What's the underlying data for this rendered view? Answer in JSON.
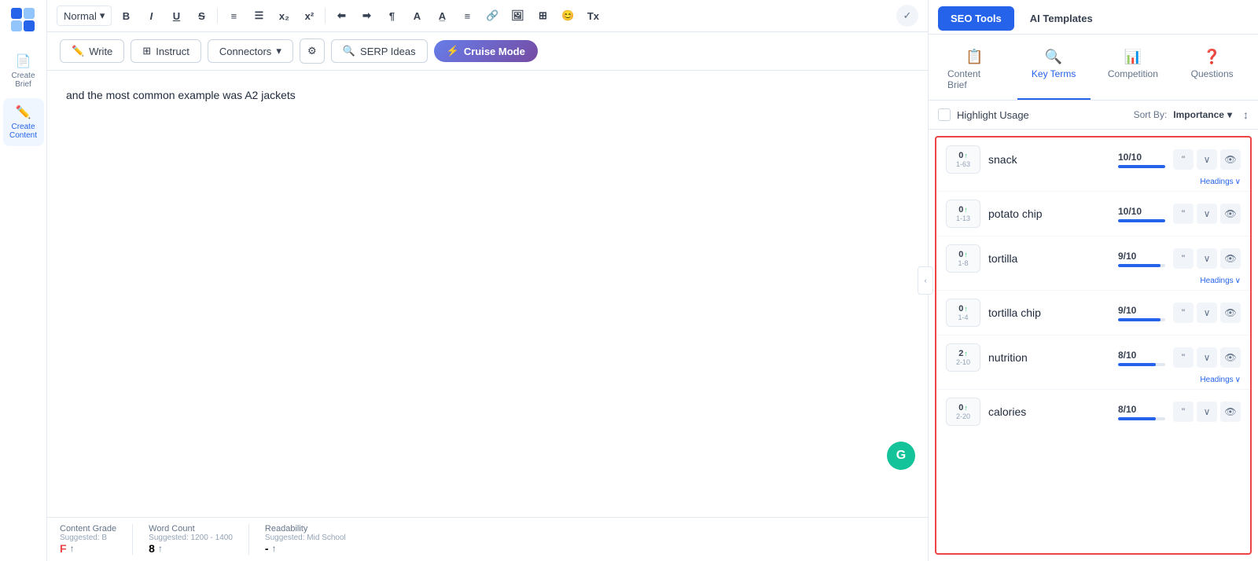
{
  "sidebar": {
    "items": [
      {
        "id": "create-brief",
        "label": "Create Brief",
        "icon": "📄",
        "active": false
      },
      {
        "id": "create-content",
        "label": "Create Content",
        "icon": "✏️",
        "active": true
      }
    ]
  },
  "toolbar": {
    "format_select": "Normal",
    "check_icon": "✓"
  },
  "action_bar": {
    "write_label": "Write",
    "instruct_label": "Instruct",
    "connectors_label": "Connectors",
    "settings_icon": "⚙",
    "serp_label": "SERP Ideas",
    "cruise_label": "Cruise Mode"
  },
  "editor": {
    "content": "and the most common example was A2 jackets"
  },
  "bottom_bar": {
    "content_grade_label": "Content Grade",
    "content_grade_suggested": "Suggested: B",
    "content_grade_value": "F",
    "word_count_label": "Word Count",
    "word_count_suggested": "Suggested: 1200 - 1400",
    "word_count_value": "8",
    "readability_label": "Readability",
    "readability_suggested": "Suggested: Mid School",
    "readability_value": "-"
  },
  "right_panel": {
    "top_tabs": [
      {
        "id": "seo-tools",
        "label": "SEO Tools",
        "active": true
      },
      {
        "id": "ai-templates",
        "label": "AI Templates",
        "active": false
      }
    ],
    "nav_tabs": [
      {
        "id": "content-brief",
        "label": "Content Brief",
        "icon": "📋",
        "active": false
      },
      {
        "id": "key-terms",
        "label": "Key Terms",
        "icon": "🔍",
        "active": true
      },
      {
        "id": "competition",
        "label": "Competition",
        "icon": "📊",
        "active": false
      },
      {
        "id": "questions",
        "label": "Questions",
        "icon": "❓",
        "active": false
      }
    ],
    "highlight_bar": {
      "checkbox_label": "Highlight Usage",
      "sort_by_label": "Sort By:",
      "sort_value": "Importance"
    },
    "terms": [
      {
        "id": "snack",
        "name": "snack",
        "count": "0",
        "arrow": "↑",
        "range": "1-63",
        "score": "10/10",
        "score_pct": 100,
        "has_headings": true
      },
      {
        "id": "potato-chip",
        "name": "potato chip",
        "count": "0",
        "arrow": "↑",
        "range": "1-13",
        "score": "10/10",
        "score_pct": 100,
        "has_headings": false
      },
      {
        "id": "tortilla",
        "name": "tortilla",
        "count": "0",
        "arrow": "↑",
        "range": "1-8",
        "score": "9/10",
        "score_pct": 90,
        "has_headings": true
      },
      {
        "id": "tortilla-chip",
        "name": "tortilla chip",
        "count": "0",
        "arrow": "↑",
        "range": "1-4",
        "score": "9/10",
        "score_pct": 90,
        "has_headings": false
      },
      {
        "id": "nutrition",
        "name": "nutrition",
        "count": "2",
        "arrow": "↑",
        "range": "2-10",
        "score": "8/10",
        "score_pct": 80,
        "has_headings": true
      },
      {
        "id": "calories",
        "name": "calories",
        "count": "0",
        "arrow": "↑",
        "range": "2-20",
        "score": "8/10",
        "score_pct": 80,
        "has_headings": false
      }
    ]
  }
}
